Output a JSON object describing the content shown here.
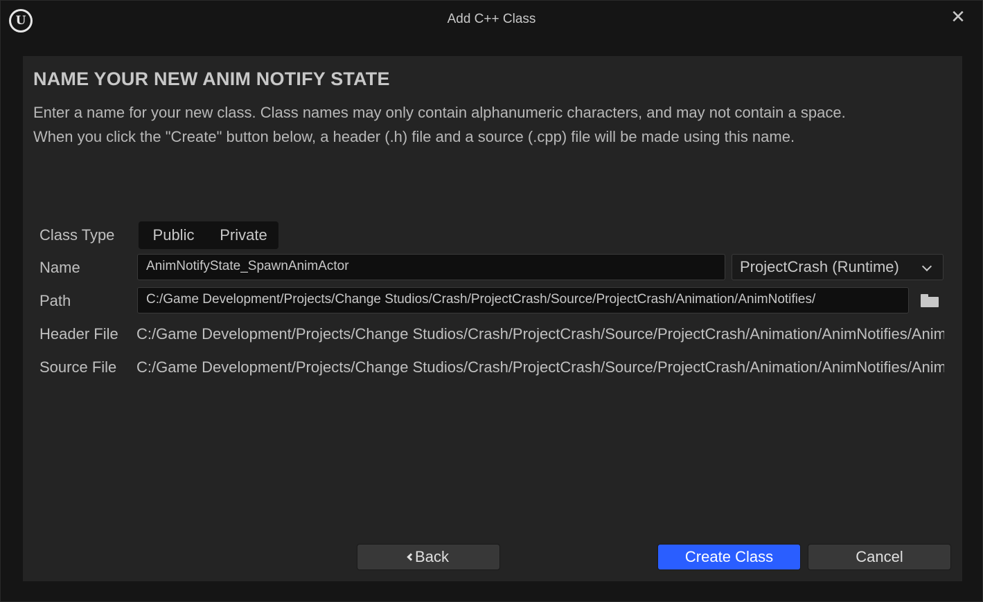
{
  "window": {
    "title": "Add C++ Class",
    "logo_text": "U",
    "close_label": "✕"
  },
  "panel": {
    "heading": "NAME YOUR NEW ANIM NOTIFY STATE",
    "description_line1": "Enter a name for your new class. Class names may only contain alphanumeric characters, and may not contain a space.",
    "description_line2": "When you click the \"Create\" button below, a header (.h) file and a source (.cpp) file will be made using this name."
  },
  "form": {
    "class_type": {
      "label": "Class Type",
      "options": [
        "Public",
        "Private"
      ]
    },
    "name": {
      "label": "Name",
      "value": "AnimNotifyState_SpawnAnimActor",
      "module": "ProjectCrash (Runtime)"
    },
    "path": {
      "label": "Path",
      "value": "C:/Game Development/Projects/Change Studios/Crash/ProjectCrash/Source/ProjectCrash/Animation/AnimNotifies/",
      "browse_icon": "folder-icon"
    },
    "header_file": {
      "label": "Header File",
      "value": "C:/Game Development/Projects/Change Studios/Crash/ProjectCrash/Source/ProjectCrash/Animation/AnimNotifies/AnimNotifyState_SpawnAnimActor.h"
    },
    "source_file": {
      "label": "Source File",
      "value": "C:/Game Development/Projects/Change Studios/Crash/ProjectCrash/Source/ProjectCrash/Animation/AnimNotifies/AnimNotifyState_SpawnAnimActor.cpp"
    }
  },
  "buttons": {
    "back": "Back",
    "create": "Create Class",
    "cancel": "Cancel"
  },
  "colors": {
    "accent": "#2a5eff",
    "panel_bg": "#242424",
    "window_bg": "#151515"
  }
}
